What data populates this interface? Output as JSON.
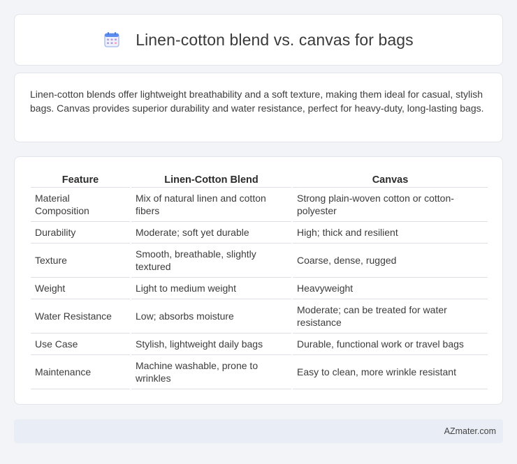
{
  "header": {
    "icon": "calendar-icon",
    "title": "Linen-cotton blend vs. canvas for bags"
  },
  "summary": {
    "text": "Linen-cotton blends offer lightweight breathability and a soft texture, making them ideal for casual, stylish bags. Canvas provides superior durability and water resistance, perfect for heavy-duty, long-lasting bags."
  },
  "table": {
    "headers": [
      "Feature",
      "Linen-Cotton Blend",
      "Canvas"
    ],
    "rows": [
      [
        "Material Composition",
        "Mix of natural linen and cotton fibers",
        "Strong plain-woven cotton or cotton-polyester"
      ],
      [
        "Durability",
        "Moderate; soft yet durable",
        "High; thick and resilient"
      ],
      [
        "Texture",
        "Smooth, breathable, slightly textured",
        "Coarse, dense, rugged"
      ],
      [
        "Weight",
        "Light to medium weight",
        "Heavyweight"
      ],
      [
        "Water Resistance",
        "Low; absorbs moisture",
        "Moderate; can be treated for water resistance"
      ],
      [
        "Use Case",
        "Stylish, lightweight daily bags",
        "Durable, functional work or travel bags"
      ],
      [
        "Maintenance",
        "Machine washable, prone to wrinkles",
        "Easy to clean, more wrinkle resistant"
      ]
    ]
  },
  "footer": {
    "brand": "AZmater.com"
  },
  "colors": {
    "background": "#f3f4f8",
    "card": "#ffffff",
    "footer_bg": "#e9edf6",
    "icon_accent": "#5b8def",
    "icon_secondary": "#b39ddb"
  }
}
